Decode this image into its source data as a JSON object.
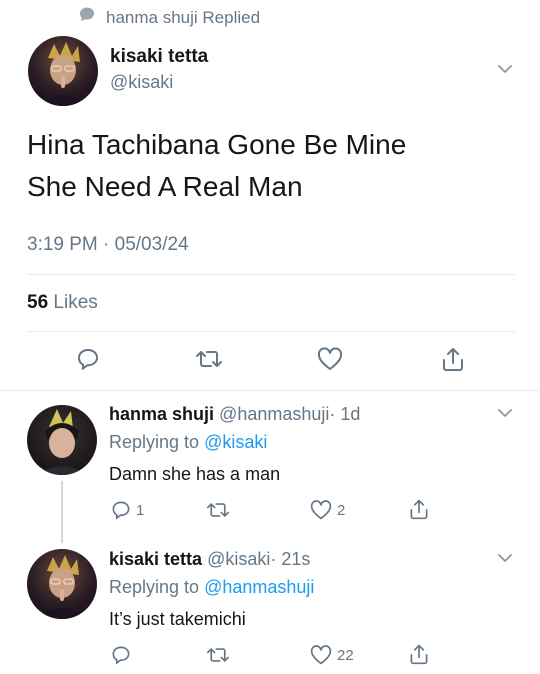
{
  "context": {
    "icon": "speech-bubble-icon",
    "label": "hanma shuji Replied"
  },
  "main_tweet": {
    "author_name": "kisaki tetta",
    "author_handle": "@kisaki",
    "line1": "Hina Tachibana Gone Be Mine",
    "line2": "She Need A Real Man",
    "timestamp": "3:19 PM · 05/03/24",
    "likes_count": "56",
    "likes_label": "Likes"
  },
  "reply1": {
    "name": "hanma shuji",
    "handle": "@hanmashuji",
    "time": "· 1d",
    "replying_prefix": "Replying to",
    "replying_to": "@kisaki",
    "text": "Damn she has a man",
    "reply_count": "1",
    "like_count": "2"
  },
  "reply2": {
    "name": "kisaki tetta",
    "handle": "@kisaki",
    "time": "· 21s",
    "replying_prefix": "Replying to",
    "replying_to": "@hanmashuji",
    "text": "It’s just takemichi",
    "like_count": "22"
  },
  "colors": {
    "accent": "#1d9bf0",
    "muted": "#657786",
    "divider": "#e6ecf0"
  }
}
